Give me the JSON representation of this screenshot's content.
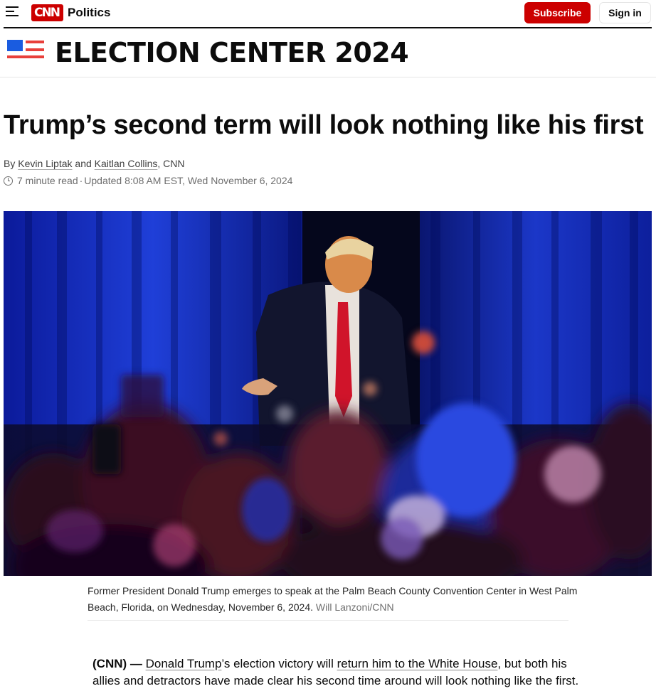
{
  "nav": {
    "logo_text": "CNN",
    "section": "Politics",
    "subscribe_label": "Subscribe",
    "signin_label": "Sign in",
    "accent_color": "#cc0000"
  },
  "banner": {
    "title": "ELECTION CENTER 2024",
    "icon": "us-flag-icon"
  },
  "article": {
    "headline": "Trump’s second term will look nothing like his first",
    "byline_prefix": "By ",
    "author_1": "Kevin Liptak",
    "byline_and": " and ",
    "author_2": "Kaitlan Collins",
    "byline_suffix": ", CNN",
    "read_time": "7 minute read",
    "separator": " · ",
    "updated": "Updated 8:08 AM EST, Wed November 6, 2024"
  },
  "image": {
    "caption": "Former President Donald Trump emerges to speak at the Palm Beach County Convention Center in West Palm Beach, Florida, on Wednesday, November 6, 2024.",
    "credit": "Will Lanzoni/CNN"
  },
  "body": {
    "dateline": "(CNN) —",
    "link_1": "Donald Trump",
    "text_1": "’s election victory will ",
    "link_2": "return him to the White House",
    "text_2": ", but both his allies and detractors have made clear his second time around will look nothing like the first."
  }
}
